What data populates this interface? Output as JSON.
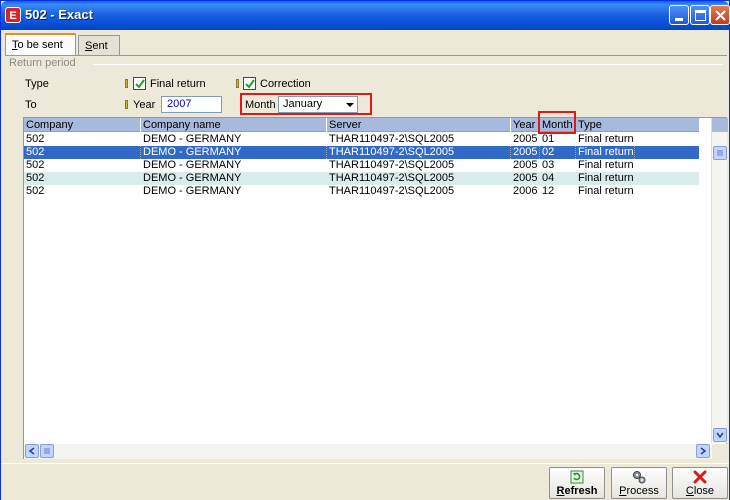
{
  "window": {
    "title": "502  - Exact",
    "icon": "E"
  },
  "tabs": [
    {
      "label": "To be sent",
      "accel": "T",
      "rest": "o be sent",
      "active": true
    },
    {
      "label": "Sent",
      "accel": "S",
      "rest": "ent",
      "active": false
    }
  ],
  "return_period": {
    "group_label": "Return period",
    "type_label": "Type",
    "final_return_label": "Final return",
    "final_return_checked": true,
    "correction_label": "Correction",
    "correction_checked": true,
    "to_label": "To",
    "year_label": "Year",
    "year_value": "2007",
    "month_label": "Month",
    "month_value": "January"
  },
  "grid": {
    "columns": [
      "Company",
      "Company name",
      "Server",
      "Year",
      "Month",
      "Type"
    ],
    "rows": [
      {
        "company": "502",
        "company_name": "DEMO - GERMANY",
        "server": "THAR110497-2\\SQL2005",
        "year": "2005",
        "month": "01",
        "type": "Final return"
      },
      {
        "company": "502",
        "company_name": "DEMO - GERMANY",
        "server": "THAR110497-2\\SQL2005",
        "year": "2005",
        "month": "02",
        "type": "Final return",
        "selected": true
      },
      {
        "company": "502",
        "company_name": "DEMO - GERMANY",
        "server": "THAR110497-2\\SQL2005",
        "year": "2005",
        "month": "03",
        "type": "Final return"
      },
      {
        "company": "502",
        "company_name": "DEMO - GERMANY",
        "server": "THAR110497-2\\SQL2005",
        "year": "2005",
        "month": "04",
        "type": "Final return"
      },
      {
        "company": "502",
        "company_name": "DEMO - GERMANY",
        "server": "THAR110497-2\\SQL2005",
        "year": "2006",
        "month": "12",
        "type": "Final return"
      }
    ]
  },
  "buttons": {
    "refresh": {
      "label": "Refresh",
      "accel": "R",
      "rest": "efresh",
      "icon": "refresh-icon"
    },
    "process": {
      "label": "Process",
      "accel": "P",
      "rest": "rocess",
      "icon": "gears-icon"
    },
    "close": {
      "label": "Close",
      "accel": "C",
      "rest": "lose",
      "icon": "close-x-icon"
    }
  },
  "colors": {
    "selection": "#3169c6",
    "highlight_box": "#e01818",
    "header_bg": "#a7b9dd",
    "alt_row": "#d9ecec"
  }
}
